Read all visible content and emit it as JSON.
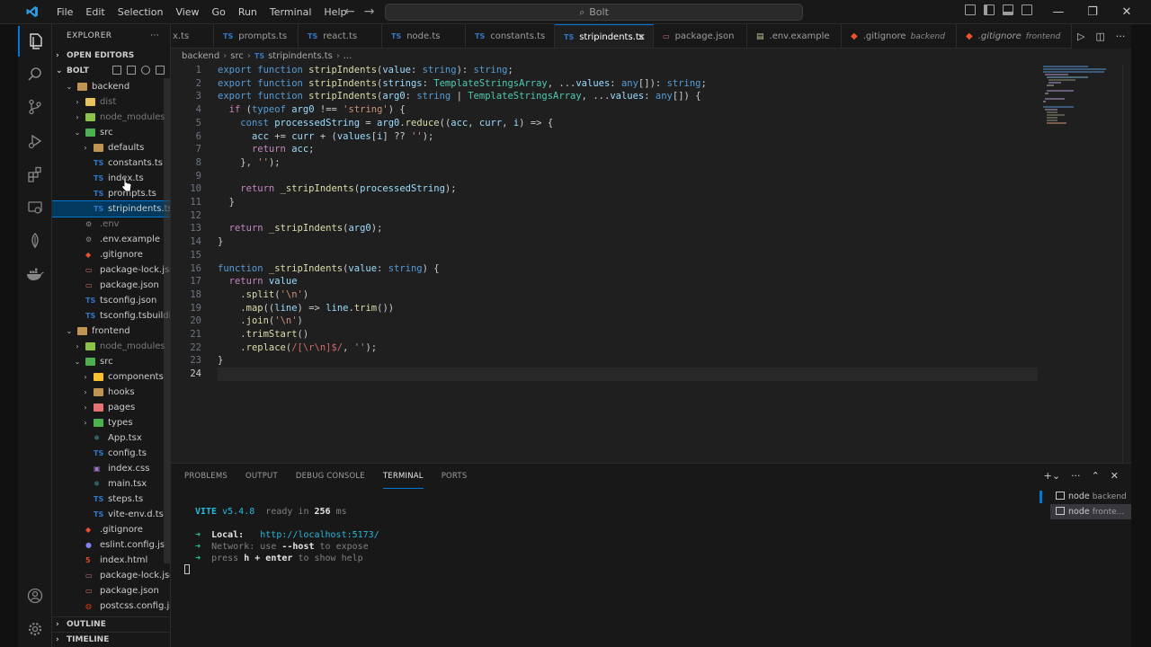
{
  "menu": [
    "File",
    "Edit",
    "Selection",
    "View",
    "Go",
    "Run",
    "Terminal",
    "Help"
  ],
  "search": {
    "label": "Bolt"
  },
  "sidebar": {
    "header": "EXPLORER",
    "open_editors": "OPEN EDITORS",
    "root": "BOLT",
    "outline": "OUTLINE",
    "timeline": "TIMELINE",
    "tree": [
      {
        "label": "backend",
        "depth": 1,
        "type": "folder",
        "open": true
      },
      {
        "label": "dist",
        "depth": 2,
        "type": "folder",
        "dim": true
      },
      {
        "label": "node_modules",
        "depth": 2,
        "type": "folder",
        "dim": true
      },
      {
        "label": "src",
        "depth": 2,
        "type": "folder",
        "open": true
      },
      {
        "label": "defaults",
        "depth": 3,
        "type": "folder"
      },
      {
        "label": "constants.ts",
        "depth": 3,
        "type": "ts"
      },
      {
        "label": "index.ts",
        "depth": 3,
        "type": "ts"
      },
      {
        "label": "prompts.ts",
        "depth": 3,
        "type": "ts"
      },
      {
        "label": "stripindents.ts",
        "depth": 3,
        "type": "ts",
        "selected": true
      },
      {
        "label": ".env",
        "depth": 2,
        "type": "env",
        "dim": true
      },
      {
        "label": ".env.example",
        "depth": 2,
        "type": "env"
      },
      {
        "label": ".gitignore",
        "depth": 2,
        "type": "git"
      },
      {
        "label": "package-lock.json",
        "depth": 2,
        "type": "json"
      },
      {
        "label": "package.json",
        "depth": 2,
        "type": "json"
      },
      {
        "label": "tsconfig.json",
        "depth": 2,
        "type": "tsconf"
      },
      {
        "label": "tsconfig.tsbuildi...",
        "depth": 2,
        "type": "tsconf"
      },
      {
        "label": "frontend",
        "depth": 1,
        "type": "folder",
        "open": true
      },
      {
        "label": "node_modules",
        "depth": 2,
        "type": "folder",
        "dim": true
      },
      {
        "label": "src",
        "depth": 2,
        "type": "folder",
        "open": true
      },
      {
        "label": "components",
        "depth": 3,
        "type": "folder"
      },
      {
        "label": "hooks",
        "depth": 3,
        "type": "folder"
      },
      {
        "label": "pages",
        "depth": 3,
        "type": "folder"
      },
      {
        "label": "types",
        "depth": 3,
        "type": "folder"
      },
      {
        "label": "App.tsx",
        "depth": 3,
        "type": "react"
      },
      {
        "label": "config.ts",
        "depth": 3,
        "type": "ts"
      },
      {
        "label": "index.css",
        "depth": 3,
        "type": "css"
      },
      {
        "label": "main.tsx",
        "depth": 3,
        "type": "react"
      },
      {
        "label": "steps.ts",
        "depth": 3,
        "type": "ts"
      },
      {
        "label": "vite-env.d.ts",
        "depth": 3,
        "type": "ts"
      },
      {
        "label": ".gitignore",
        "depth": 2,
        "type": "git"
      },
      {
        "label": "eslint.config.js",
        "depth": 2,
        "type": "eslint"
      },
      {
        "label": "index.html",
        "depth": 2,
        "type": "html"
      },
      {
        "label": "package-lock.json",
        "depth": 2,
        "type": "json"
      },
      {
        "label": "package.json",
        "depth": 2,
        "type": "json"
      },
      {
        "label": "postcss.config.js",
        "depth": 2,
        "type": "postcss"
      }
    ]
  },
  "tabs": [
    {
      "label": "x.ts",
      "icon": "none"
    },
    {
      "label": "prompts.ts",
      "icon": "ts"
    },
    {
      "label": "react.ts",
      "icon": "ts"
    },
    {
      "label": "node.ts",
      "icon": "ts"
    },
    {
      "label": "constants.ts",
      "icon": "ts"
    },
    {
      "label": "stripindents.ts",
      "icon": "ts",
      "active": true
    },
    {
      "label": "package.json",
      "icon": "json"
    },
    {
      "label": ".env.example",
      "icon": "env"
    },
    {
      "label": ".gitignore",
      "icon": "git",
      "desc": "backend"
    },
    {
      "label": ".gitignore",
      "icon": "git",
      "desc": "frontend"
    }
  ],
  "breadcrumb": [
    "backend",
    "src",
    "stripindents.ts",
    "..."
  ],
  "editor": {
    "current_line": 24,
    "lines": [
      "export function stripIndents(value: string): string;",
      "export function stripIndents(strings: TemplateStringsArray, ...values: any[]): string;",
      "export function stripIndents(arg0: string | TemplateStringsArray, ...values: any[]) {",
      "  if (typeof arg0 !== 'string') {",
      "    const processedString = arg0.reduce((acc, curr, i) => {",
      "      acc += curr + (values[i] ?? '');",
      "      return acc;",
      "    }, '');",
      "",
      "    return _stripIndents(processedString);",
      "  }",
      "",
      "  return _stripIndents(arg0);",
      "}",
      "",
      "function _stripIndents(value: string) {",
      "  return value",
      "    .split('\\n')",
      "    .map((line) => line.trim())",
      "    .join('\\n')",
      "    .trimStart()",
      "    .replace(/[\\r\\n]$/, '');",
      "}",
      ""
    ]
  },
  "panel": {
    "tabs": [
      "PROBLEMS",
      "OUTPUT",
      "DEBUG CONSOLE",
      "TERMINAL",
      "PORTS"
    ],
    "active_tab": "TERMINAL",
    "terminal": {
      "vite": "VITE",
      "version": "v5.4.8",
      "ready": "ready in",
      "ms": "256",
      "ms_unit": "ms",
      "local_label": "Local:",
      "local_url": "http://localhost:5173/",
      "network_label": "Network:",
      "network_text_a": "use",
      "network_host": "--host",
      "network_text_b": "to expose",
      "help_a": "press",
      "help_key": "h + enter",
      "help_b": "to show help"
    },
    "terminals": [
      {
        "name": "node",
        "sub": "backend"
      },
      {
        "name": "node",
        "sub": "fronte...",
        "active": true
      }
    ]
  }
}
